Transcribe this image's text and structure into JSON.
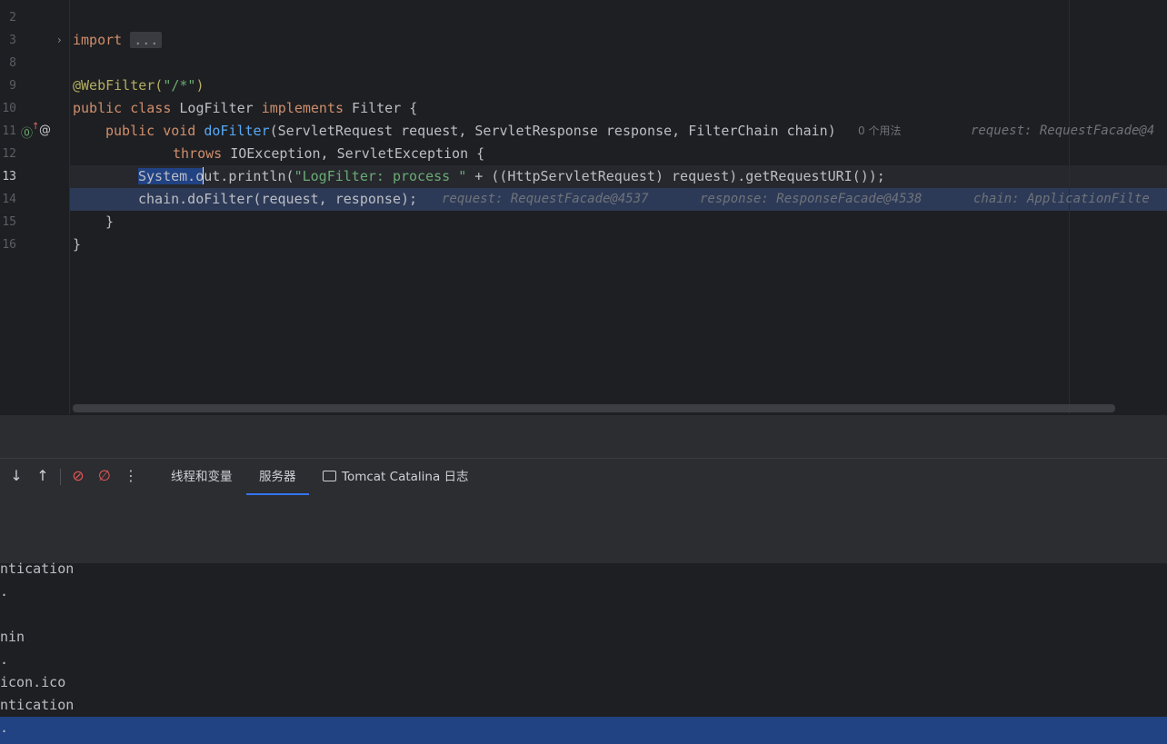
{
  "editor": {
    "gutter": {
      "line_numbers": [
        "2",
        "3",
        "8",
        "9",
        "10",
        "11",
        "12",
        "13",
        "14",
        "15",
        "16"
      ]
    },
    "lines": {
      "l3_kw": "import",
      "l3_fold": "...",
      "l9_ann": "@WebFilter(",
      "l9_str": "\"/*\"",
      "l9_close": ")",
      "l10_kw1": "public class",
      "l10_name": " LogFilter ",
      "l10_kw2": "implements",
      "l10_rest": " Filter {",
      "l11_kw": "public void",
      "l11_fn": "doFilter",
      "l11_rest": "(ServletRequest request, ServletResponse response, FilterChain chain)",
      "l11_usage": "0 个用法",
      "l11_dbg": "request: RequestFacade@4",
      "l12_kw": "throws",
      "l12_rest": " IOException, ServletException {",
      "l13_sel": "System.o",
      "l13_rest": "ut.println(",
      "l13_str": "\"LogFilter: process \"",
      "l13_tail": " + ((HttpServletRequest) request).getRequestURI());",
      "l14_code": "chain.doFilter(request, response);",
      "l14_dbg1": "request: RequestFacade@4537",
      "l14_dbg2": "response: ResponseFacade@4538",
      "l14_dbg3": "chain: ApplicationFilte",
      "l15": "}",
      "l16": "}"
    }
  },
  "toolbar": {
    "icons": {
      "download": "↓",
      "upload": "↑",
      "breakpoints": "⊘",
      "mute_breakpoints": "∅",
      "more": "⋮"
    },
    "tabs": [
      {
        "label": "线程和变量"
      },
      {
        "label": "服务器"
      },
      {
        "label": "Tomcat Catalina 日志"
      }
    ]
  },
  "log": {
    "lines": [
      "ntication",
      ".",
      "nin",
      ".",
      "icon.ico",
      "ntication",
      "."
    ]
  },
  "colors": {
    "background": "#1e1f22",
    "panel": "#2b2d30",
    "keyword": "#cf8e6d",
    "function": "#56a8f5",
    "annotation": "#b3ae60",
    "string": "#6aab73",
    "selection": "#214283",
    "tab_underline": "#3574f0"
  }
}
